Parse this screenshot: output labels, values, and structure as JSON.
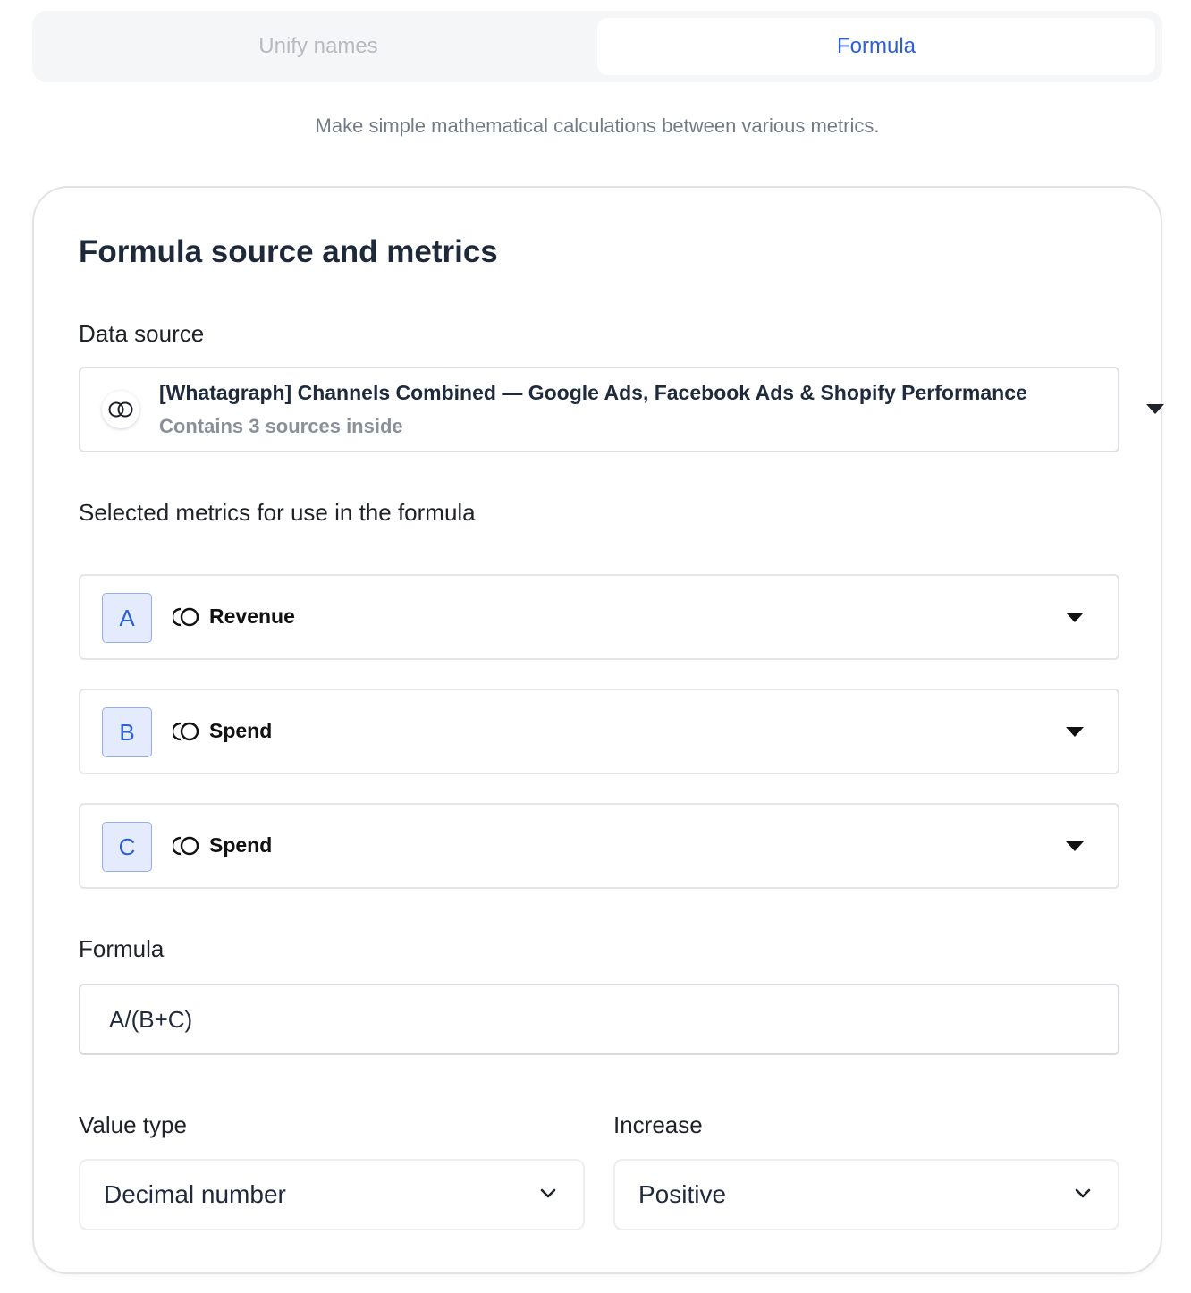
{
  "tabs": [
    {
      "label": "Unify names",
      "active": false
    },
    {
      "label": "Formula",
      "active": true
    }
  ],
  "subtitle": "Make simple mathematical calculations between various metrics.",
  "card": {
    "title": "Formula source and metrics",
    "data_source": {
      "label": "Data source",
      "name": "[Whatagraph] Channels Combined — Google Ads, Facebook Ads & Shopify Performance",
      "sub": "Contains 3 sources inside",
      "icon": "linked-circles-icon"
    },
    "metrics_label": "Selected metrics for use in the formula",
    "metrics": [
      {
        "letter": "A",
        "name": "Revenue",
        "icon": "channels-combined-icon"
      },
      {
        "letter": "B",
        "name": "Spend",
        "icon": "channels-combined-icon"
      },
      {
        "letter": "C",
        "name": "Spend",
        "icon": "channels-combined-icon"
      }
    ],
    "formula": {
      "label": "Formula",
      "value": "A/(B+C)"
    },
    "value_type": {
      "label": "Value type",
      "value": "Decimal number"
    },
    "increase": {
      "label": "Increase",
      "value": "Positive"
    }
  },
  "colors": {
    "accent": "#2f5fd6",
    "letter_bg": "#e4ebfd"
  }
}
